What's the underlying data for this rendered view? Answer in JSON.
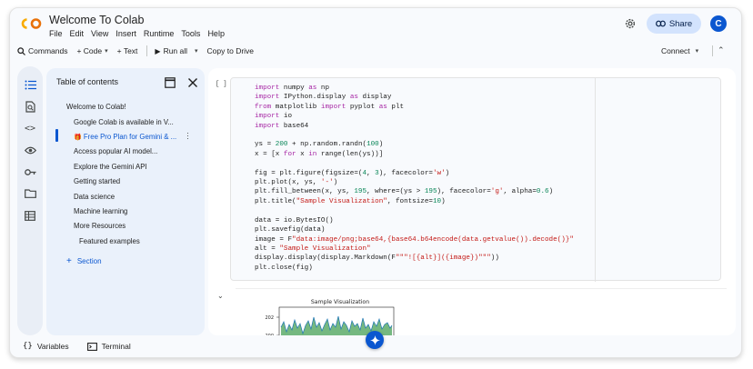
{
  "header": {
    "title": "Welcome To Colab",
    "logo_text": "CO",
    "menus": [
      "File",
      "Edit",
      "View",
      "Insert",
      "Runtime",
      "Tools",
      "Help"
    ],
    "share_label": "Share",
    "avatar_initial": "C"
  },
  "toolbar": {
    "commands_label": "Commands",
    "code_label": "+ Code",
    "text_label": "+ Text",
    "run_all_label": "Run all",
    "copy_to_drive_label": "Copy to Drive",
    "connect_label": "Connect"
  },
  "toc": {
    "title": "Table of contents",
    "items": [
      "Welcome to Colab!",
      "Google Colab is available in V...",
      "Free Pro Plan for Gemini & ...",
      "Access popular AI model...",
      "Explore the Gemini API",
      "Getting started",
      "Data science",
      "Machine learning",
      "More Resources",
      "Featured examples"
    ],
    "selected_badge": "🎁",
    "add_section_label": "Section"
  },
  "cell": {
    "run_bracket": "[ ]"
  },
  "output": {
    "plot_title": "Sample Visualization",
    "y_ticks": [
      "202",
      "200"
    ]
  },
  "bottom": {
    "variables_label": "Variables",
    "terminal_label": "Terminal"
  },
  "colors": {
    "accent": "#0b57d0",
    "share_bg": "#d3e3fd",
    "toc_bg": "#eaf1fb",
    "logo_orange": "#f9ab00"
  }
}
